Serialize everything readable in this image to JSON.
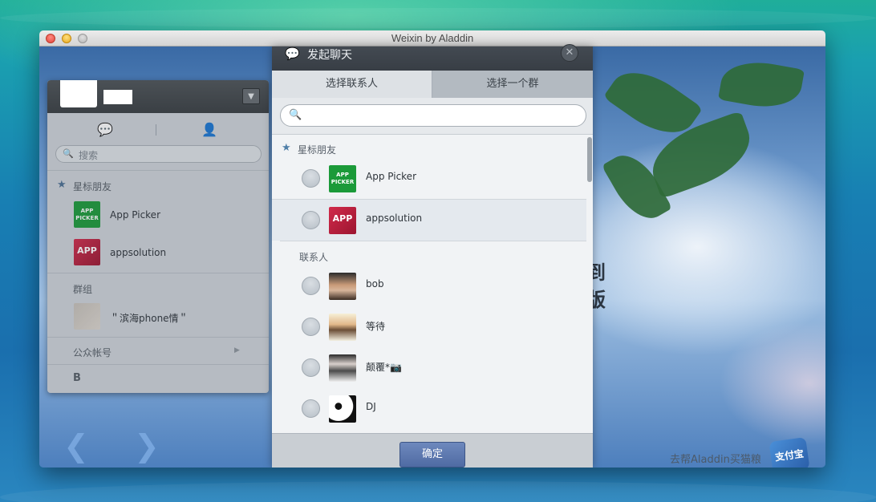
{
  "window": {
    "title": "Weixin by Aladdin"
  },
  "sidebar": {
    "search_placeholder": "搜索",
    "sections": {
      "starred": "星标朋友",
      "groups": "群组",
      "official": "公众帐号",
      "letter_b": "B"
    },
    "starred_items": [
      {
        "name": "App Picker",
        "thumb": "app-picker-logo"
      },
      {
        "name": "appsolution",
        "thumb": "appsolution-logo"
      }
    ],
    "group_items": [
      {
        "name": "＂滨海phone情＂",
        "thumb": "group-collage"
      }
    ]
  },
  "dialog": {
    "title": "发起聊天",
    "tabs": [
      {
        "label": "选择联系人",
        "active": true
      },
      {
        "label": "选择一个群",
        "active": false
      }
    ],
    "search_value": "",
    "sections": {
      "starred": "星标朋友",
      "contacts": "联系人"
    },
    "starred_contacts": [
      {
        "name": "App Picker"
      },
      {
        "name": "appsolution"
      }
    ],
    "contacts": [
      {
        "name": "bob"
      },
      {
        "name": "等待"
      },
      {
        "name": "颠覆*📷"
      },
      {
        "name": "DJ"
      }
    ],
    "confirm_label": "确定"
  },
  "background": {
    "main_text_line1": "到",
    "main_text_line2": "版",
    "promo_text": "去帮Aladdin买猫粮",
    "promo_icon_label": "支付宝"
  },
  "colors": {
    "ok_button": "#5874ab",
    "dialog_header": "#3d434a",
    "starred_star": "#4f7ea7"
  }
}
